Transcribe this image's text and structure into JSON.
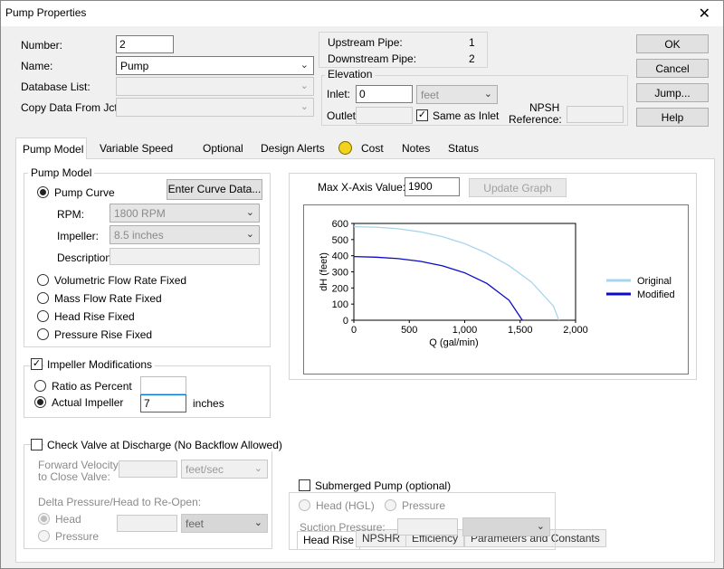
{
  "window": {
    "title": "Pump Properties",
    "close": "✕"
  },
  "fields": {
    "number_label": "Number:",
    "number_value": "2",
    "name_label": "Name:",
    "name_value": "Pump",
    "database_label": "Database List:",
    "database_value": "",
    "copy_label": "Copy Data From Jct...",
    "copy_value": ""
  },
  "pipes": {
    "upstream_label": "Upstream Pipe:",
    "upstream_value": "1",
    "downstream_label": "Downstream Pipe:",
    "downstream_value": "2"
  },
  "elevation": {
    "title": "Elevation",
    "inlet_label": "Inlet:",
    "inlet_value": "0",
    "unit": "feet",
    "outlet_label": "Outlet:",
    "outlet_value": "",
    "same_as_inlet": "Same as Inlet",
    "npsh_label": "NPSH",
    "npsh_ref_label": "Reference:",
    "npsh_value": ""
  },
  "buttons": {
    "ok": "OK",
    "cancel": "Cancel",
    "jump": "Jump...",
    "help": "Help"
  },
  "tabs": [
    {
      "label": "Pump Model"
    },
    {
      "label": "Variable Speed"
    },
    {
      "label": "Optional"
    },
    {
      "label": "Design Alerts"
    },
    {
      "label": "Cost"
    },
    {
      "label": "Notes"
    },
    {
      "label": "Status"
    }
  ],
  "pump_model": {
    "title": "Pump Model",
    "pump_curve": "Pump Curve",
    "enter_curve": "Enter Curve Data...",
    "rpm_label": "RPM:",
    "rpm_value": "1800 RPM",
    "impeller_label": "Impeller:",
    "impeller_value": "8.5 inches",
    "description_label": "Description:",
    "description_value": "",
    "options": [
      "Volumetric Flow Rate Fixed",
      "Mass Flow Rate Fixed",
      "Head Rise Fixed",
      "Pressure Rise Fixed"
    ]
  },
  "impeller_mod": {
    "title": "Impeller Modifications",
    "ratio_label": "Ratio as Percent",
    "ratio_value": "",
    "actual_label": "Actual Impeller",
    "actual_value": "7",
    "unit": "inches"
  },
  "check_valve": {
    "title": "Check Valve at Discharge (No Backflow Allowed)",
    "velocity_label_1": "Forward Velocity",
    "velocity_label_2": "to Close Valve:",
    "velocity_value": "",
    "velocity_unit": "feet/sec",
    "delta_label": "Delta Pressure/Head to Re-Open:",
    "head": "Head",
    "pressure": "Pressure",
    "delta_value": "",
    "delta_unit": "feet"
  },
  "submerged": {
    "title": "Submerged Pump (optional)",
    "head_hgl": "Head (HGL)",
    "pressure": "Pressure",
    "suction_label": "Suction Pressure:",
    "suction_value": "",
    "suction_unit": ""
  },
  "graph": {
    "max_x_label": "Max X-Axis Value:",
    "max_x_value": "1900",
    "update": "Update Graph",
    "subtabs": [
      "Head Rise",
      "NPSHR",
      "Efficiency",
      "Parameters and Constants"
    ]
  },
  "chart_data": {
    "type": "line",
    "xlabel": "Q (gal/min)",
    "ylabel": "dH (feet)",
    "xlim": [
      0,
      2000
    ],
    "ylim": [
      0,
      600
    ],
    "xticks": [
      0,
      500,
      1000,
      1500,
      2000
    ],
    "xtick_labels": [
      "0",
      "500",
      "1,000",
      "1,500",
      "2,000"
    ],
    "yticks": [
      0,
      100,
      200,
      300,
      400,
      500,
      600
    ],
    "ytick_labels": [
      "0",
      "100",
      "200",
      "300",
      "400",
      "500",
      "600"
    ],
    "grid": false,
    "legend_position": "right",
    "series": [
      {
        "name": "Original",
        "color": "#a8d4ee",
        "x": [
          0,
          200,
          400,
          600,
          800,
          1000,
          1200,
          1400,
          1600,
          1800,
          1850
        ],
        "y": [
          580,
          577,
          567,
          548,
          518,
          475,
          415,
          338,
          238,
          88,
          0
        ]
      },
      {
        "name": "Modified",
        "color": "#0a0ac8",
        "x": [
          0,
          200,
          400,
          600,
          800,
          1000,
          1200,
          1400,
          1520
        ],
        "y": [
          395,
          391,
          382,
          365,
          337,
          294,
          228,
          124,
          0
        ]
      }
    ]
  }
}
